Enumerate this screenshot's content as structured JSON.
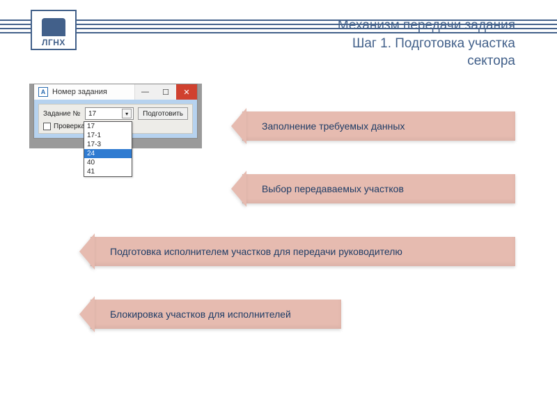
{
  "logo": {
    "text": "ЛГНХ"
  },
  "title": {
    "line1": "Механизм передачи задания",
    "line2": "Шаг 1. Подготовка участка",
    "line3": "сектора"
  },
  "window": {
    "title": "Номер задания",
    "app_icon": "A",
    "label_task": "Задание №",
    "selected_value": "17",
    "button": "Подготовить",
    "checkbox_label": "Проверка",
    "options": [
      "17",
      "17-1",
      "17-3",
      "24",
      "40",
      "41"
    ],
    "selected_option": "24"
  },
  "banners": {
    "b1": "Заполнение требуемых данных",
    "b2": "Выбор передаваемых участков",
    "b3": "Подготовка исполнителем участков для передачи руководителю",
    "b4": "Блокировка участков для исполнителей"
  }
}
